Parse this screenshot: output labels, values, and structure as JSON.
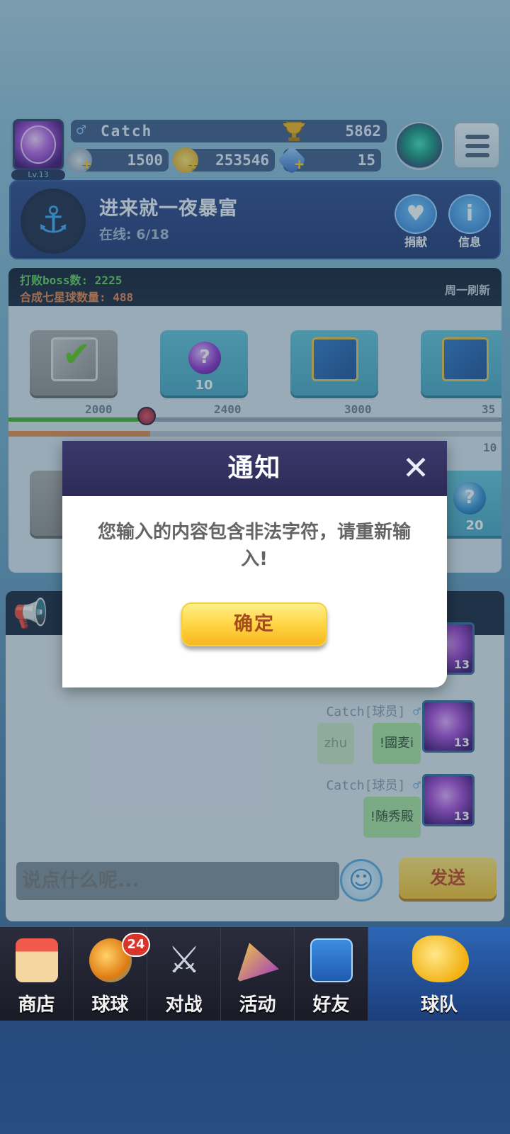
{
  "player": {
    "level": "Lv.13",
    "name": "Catch",
    "trophies": "5862",
    "resource1": "1500",
    "coins": "253546",
    "gems": "15"
  },
  "team": {
    "name": "进来就一夜暴富",
    "online": "在线: 6/18",
    "donate_label": "捐献",
    "info_label": "信息"
  },
  "progress": {
    "boss_defeated": "打败boss数: 2225",
    "seven_star": "合成七星球数量: 488",
    "weekly_refresh": "周一刷新",
    "rewards": [
      {
        "qty": "",
        "milestone": "2000"
      },
      {
        "qty": "10",
        "milestone": "2400"
      },
      {
        "qty": "",
        "milestone": "3000"
      },
      {
        "qty": "",
        "milestone": "35"
      }
    ],
    "row2_milestone": "10",
    "row2_reward_qty": "20"
  },
  "chat": {
    "messages": [
      {
        "sender": "Catch[球员]",
        "text": "!國麦i",
        "ghost_text": "zhu",
        "level": "13"
      },
      {
        "sender": "Catch[球员]",
        "text": "!随秀殿",
        "level": "13"
      }
    ],
    "top_avatar_level": "13",
    "input_placeholder": "说点什么呢...",
    "send_label": "发送"
  },
  "dialog": {
    "title": "通知",
    "message": "您输入的内容包含非法字符，请重新输入!",
    "ok_label": "确定"
  },
  "nav": {
    "items": [
      {
        "label": "商店"
      },
      {
        "label": "球球"
      },
      {
        "label": "对战"
      },
      {
        "label": "活动"
      },
      {
        "label": "好友"
      },
      {
        "label": "球队"
      }
    ],
    "ball_badge": "24"
  },
  "colors": {
    "dialog_header": "#2c2a56",
    "ok_button": "#ffd84a",
    "chat_bubble": "#a6e59c",
    "nav_active": "#2d66b5"
  }
}
